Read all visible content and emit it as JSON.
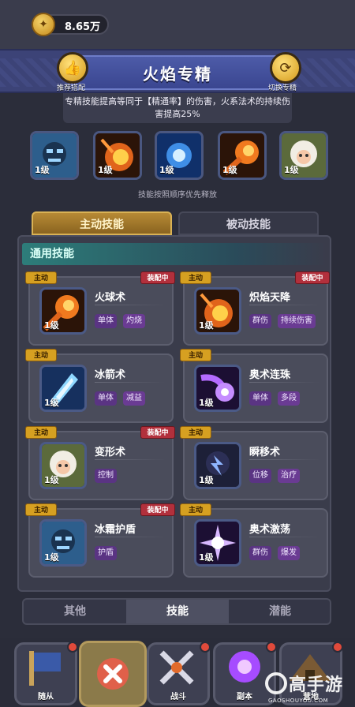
{
  "currency": {
    "amount": "8.65万",
    "icon": "wheat-coin-icon"
  },
  "banner": {
    "title": "火焰专精",
    "left_button_label": "推荐搭配",
    "right_button_label": "切换专精",
    "description": "专精技能提高等同于【精通率】的伤害，火系法术的持续伤害提高25%"
  },
  "equipped_slots": [
    {
      "name": "冰霜护盾",
      "level": "1级"
    },
    {
      "name": "炽焰天降",
      "level": "1级"
    },
    {
      "name": "奥术连珠",
      "level": "1级"
    },
    {
      "name": "火球术",
      "level": "1级"
    },
    {
      "name": "变形术",
      "level": "1级"
    }
  ],
  "slots_hint": "技能按照顺序优先释放",
  "tabs": {
    "active": "主动技能",
    "passive": "被动技能"
  },
  "section_title": "通用技能",
  "badge_active": "主动",
  "badge_equipped": "装配中",
  "skills": [
    {
      "name": "火球术",
      "level": "1级",
      "equipped": true,
      "tags": [
        "单体",
        "灼烧"
      ]
    },
    {
      "name": "炽焰天降",
      "level": "1级",
      "equipped": true,
      "tags": [
        "群伤",
        "持续伤害"
      ]
    },
    {
      "name": "冰箭术",
      "level": "1级",
      "equipped": false,
      "tags": [
        "单体",
        "减益"
      ]
    },
    {
      "name": "奥术连珠",
      "level": "1级",
      "equipped": true,
      "tags": [
        "单体",
        "多段"
      ]
    },
    {
      "name": "变形术",
      "level": "1级",
      "equipped": true,
      "tags": [
        "控制"
      ]
    },
    {
      "name": "瞬移术",
      "level": "1级",
      "equipped": false,
      "tags": [
        "位移",
        "治疗"
      ]
    },
    {
      "name": "冰霜护盾",
      "level": "1级",
      "equipped": true,
      "tags": [
        "护盾"
      ]
    },
    {
      "name": "奥术激荡",
      "level": "1级",
      "equipped": false,
      "tags": [
        "群伤",
        "爆发"
      ]
    }
  ],
  "subtabs": [
    "其他",
    "技能",
    "潜能"
  ],
  "subtab_active": "技能",
  "nav": [
    {
      "label": "随从"
    },
    {
      "label": "战斗"
    },
    {
      "label": "副本"
    },
    {
      "label": "营地"
    }
  ],
  "watermark": {
    "text": "高手游",
    "sub": "GAOSHOUYOU.COM"
  }
}
